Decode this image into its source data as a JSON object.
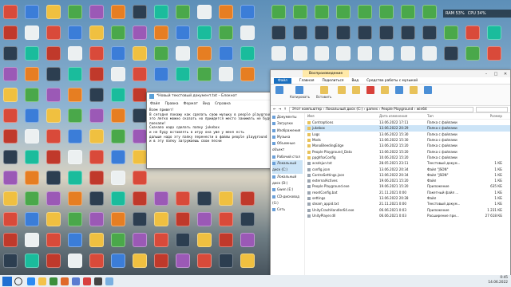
{
  "gadget": {
    "ram": "RAM 53%",
    "cpu": "CPU 34%"
  },
  "notepad": {
    "title": "*Новый текстовый документ.txt – Блокнот",
    "menu": [
      "Файл",
      "Правка",
      "Формат",
      "Вид",
      "Справка"
    ],
    "text": "Всем привет!\nВ сегодня покажу как сделать свою музыку в people playground!\nэто легко можно сказать но прийдется место занимать не буду тянуть\nпоехали!\nСначало надо сделать папку jukebox\nи не буду вставлять в игру она уже у меня есть\nдальше надо эту папку перенести в файлы people playground\nи в эту папку загружаешь свои песни"
  },
  "explorer": {
    "title_tab": "Воспроизведение",
    "tabs": [
      "Файл",
      "Главная",
      "Поделиться",
      "Вид",
      "Средства работы с музыкой"
    ],
    "ribbon": [
      "Закрепить на панели быстрого доступа",
      "Копировать",
      "Вставить",
      "Переместить в",
      "Копировать в",
      "Удалить",
      "Переименовать",
      "Новая папка",
      "Свойства",
      "Открыть",
      "Выделить"
    ],
    "ribbon_groups": [
      "Буфер обмена",
      "Упорядочить",
      "Создать",
      "Открыть"
    ],
    "address": "Этот компьютер › Локальный диск (C:) › games › People Playground › win64",
    "nav": [
      {
        "label": "Документы",
        "selected": false
      },
      {
        "label": "Загрузки",
        "selected": false
      },
      {
        "label": "Изображения",
        "selected": false
      },
      {
        "label": "Музыка",
        "selected": false
      },
      {
        "label": "Объемные объект",
        "selected": false
      },
      {
        "label": "Рабочий стол",
        "selected": false
      },
      {
        "label": "Локальный диск (C:)",
        "selected": true
      },
      {
        "label": "Локальный диск (D:)",
        "selected": false
      },
      {
        "label": "Gwen (E:)",
        "selected": false
      },
      {
        "label": "CD-дисковод (G:)",
        "selected": false
      },
      {
        "label": "Сеть",
        "selected": false
      }
    ],
    "columns": [
      "Имя",
      "Дата изменения",
      "Тип",
      "Размер"
    ],
    "rows": [
      {
        "name": "Contraptions",
        "date": "13.06.2022 17:11",
        "type": "Папка с файлами",
        "size": "",
        "folder": true,
        "selected": false
      },
      {
        "name": "jukebox",
        "date": "13.06.2022 20:29",
        "type": "Папка с файлами",
        "size": "",
        "folder": true,
        "selected": true
      },
      {
        "name": "Logs",
        "date": "13.06.2022 15:30",
        "type": "Папка с файлами",
        "size": "",
        "folder": true,
        "selected": false
      },
      {
        "name": "Mods",
        "date": "13.06.2022 15:30",
        "type": "Папка с файлами",
        "size": "",
        "folder": true,
        "selected": false
      },
      {
        "name": "MonoBleedingEdge",
        "date": "13.06.2022 15:20",
        "type": "Папка с файлами",
        "size": "",
        "folder": true,
        "selected": false
      },
      {
        "name": "People Playground_Data",
        "date": "13.06.2022 15:20",
        "type": "Папка с файлами",
        "size": "",
        "folder": true,
        "selected": false
      },
      {
        "name": "ppghfsxConfig",
        "date": "10.06.2022 15:20",
        "type": "Папка с файлами",
        "size": "",
        "folder": true,
        "selected": false
      },
      {
        "name": "acsdsjun.txt",
        "date": "28.05.2021 23:11",
        "type": "Текстовый докум...",
        "size": "1 КБ",
        "folder": false,
        "selected": false
      },
      {
        "name": "config.json",
        "date": "13.06.2022 20:34",
        "type": "Файл \"JSON\"",
        "size": "1 КБ",
        "folder": false,
        "selected": false
      },
      {
        "name": "ContraSettings.json",
        "date": "13.06.2022 20:34",
        "type": "Файл \"JSON\"",
        "size": "1 КБ",
        "folder": false,
        "selected": false
      },
      {
        "name": "externalActives",
        "date": "19.06.2021 15:20",
        "type": "Файл",
        "size": "1 КБ",
        "folder": false,
        "selected": false
      },
      {
        "name": "People Playground.exe",
        "date": "19.06.2021 15:20",
        "type": "Приложение",
        "size": "635 КБ",
        "folder": false,
        "selected": false
      },
      {
        "name": "resetConfig.bat",
        "date": "21.11.2021 0:00",
        "type": "Пакетный файл ...",
        "size": "1 КБ",
        "folder": false,
        "selected": false
      },
      {
        "name": "settings",
        "date": "13.06.2022 20:28",
        "type": "Файл",
        "size": "1 КБ",
        "folder": false,
        "selected": false
      },
      {
        "name": "steam_appid.txt",
        "date": "21.11.2021 0:00",
        "type": "Текстовый докум...",
        "size": "1 КБ",
        "folder": false,
        "selected": false
      },
      {
        "name": "UnityCrashHandler64.exe",
        "date": "06.06.2021 0:03",
        "type": "Приложение",
        "size": "1 231 КБ",
        "folder": false,
        "selected": false
      },
      {
        "name": "UnityPlayer.dll",
        "date": "06.06.2021 0:03",
        "type": "Расширение при...",
        "size": "27 618 КБ",
        "folder": false,
        "selected": false
      }
    ],
    "status": [
      "Элементов: 17",
      "Выбран 1 элемент"
    ]
  },
  "taskbar": {
    "time": "0:45",
    "date": "14.06.2022",
    "lang": "РУС"
  }
}
